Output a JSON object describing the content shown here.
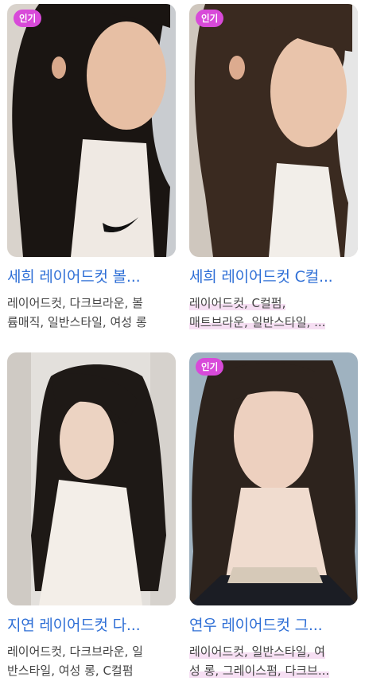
{
  "colors": {
    "title": "#2f6fd6",
    "badge": "#d84ad9",
    "tag_highlight": "#f6dff3"
  },
  "cards": [
    {
      "badge": "인기",
      "title": "세희 레이어드컷 볼...",
      "tags_line1": "레이어드컷, 다크브라운, 볼",
      "tags_line2": "륨매직, 일반스타일, 여성 롱",
      "image": "woman-long-layered-hair-side-profile"
    },
    {
      "badge": "인기",
      "title": "세희 레이어드컷 C컬...",
      "tags_line1": "레이어드컷, C컬펌,",
      "tags_line2": "매트브라운, 일반스타일, ...",
      "image": "woman-layered-hair-bangs-profile"
    },
    {
      "badge": "",
      "title": "지연 레이어드컷 다...",
      "tags_line1": "레이어드컷, 다크브라운, 일",
      "tags_line2": "반스타일, 여성 롱, C컬펌",
      "image": "woman-long-layered-hair-salon"
    },
    {
      "badge": "인기",
      "title": "연우 레이어드컷 그...",
      "tags_line1": "레이어드컷, 일반스타일, 여",
      "tags_line2": "성 롱, 그레이스펌, 다크브...",
      "image": "woman-wavy-layered-hair-front"
    }
  ]
}
